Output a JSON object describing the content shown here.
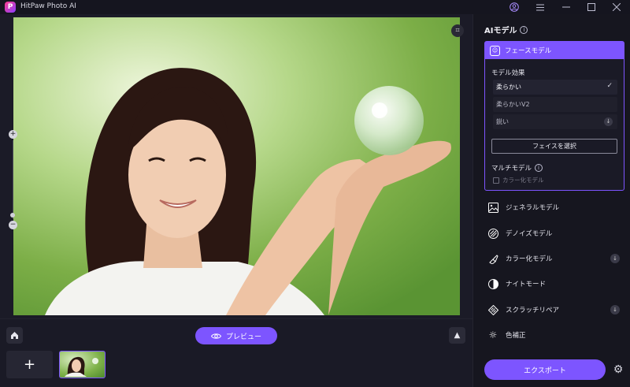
{
  "app": {
    "title": "HitPaw Photo AI"
  },
  "titlebar": {
    "account_icon": "user-circle-icon",
    "menu_icon": "hamburger-menu-icon",
    "minimize_icon": "minimize-icon",
    "maximize_icon": "maximize-icon",
    "close_icon": "close-icon"
  },
  "bottom": {
    "preview_label": "プレビュー",
    "add_label": "+"
  },
  "panel": {
    "title": "AIモデル",
    "face_model": {
      "label": "フェースモデル",
      "effect_label": "モデル効果",
      "options": [
        {
          "label": "柔らかい",
          "selected": true
        },
        {
          "label": "柔らかいV2",
          "selected": false
        },
        {
          "label": "鋭い",
          "selected": false
        }
      ],
      "select_face_button": "フェイスを選択",
      "multi_model_label": "マルチモデル",
      "multi_model_option": "カラー化モデル"
    },
    "models": [
      {
        "label": "ジェネラルモデル",
        "icon": "image-icon",
        "download": false
      },
      {
        "label": "デノイズモデル",
        "icon": "denoise-icon",
        "download": false
      },
      {
        "label": "カラー化モデル",
        "icon": "colorize-brush-icon",
        "download": true
      },
      {
        "label": "ナイトモード",
        "icon": "half-circle-icon",
        "download": false
      },
      {
        "label": "スクラッチリペア",
        "icon": "scratch-repair-icon",
        "download": true
      },
      {
        "label": "色補正",
        "icon": "sun-icon",
        "download": false
      }
    ],
    "export_label": "エクスポート"
  },
  "colors": {
    "accent": "#7d55ff",
    "panel_bg": "#16161f",
    "canvas_bg": "#1b1b27"
  }
}
